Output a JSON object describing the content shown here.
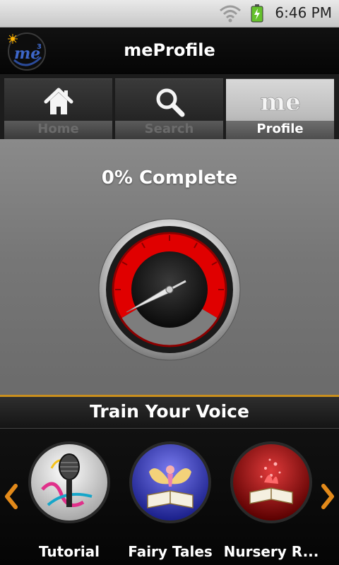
{
  "status_bar": {
    "time": "6:46 PM"
  },
  "app": {
    "title": "meProfile",
    "logo_text": "me"
  },
  "tabs": [
    {
      "label": "Home",
      "icon": "home-icon",
      "active": false
    },
    {
      "label": "Search",
      "icon": "search-icon",
      "active": false
    },
    {
      "label": "Profile",
      "icon": "me-icon",
      "active": true,
      "icon_text": "me"
    }
  ],
  "profile": {
    "progress_label": "0% Complete",
    "progress_value": 0
  },
  "train": {
    "title": "Train Your Voice",
    "items": [
      {
        "label": "Tutorial",
        "icon": "microphone-icon"
      },
      {
        "label": "Fairy Tales",
        "icon": "fairy-book-icon"
      },
      {
        "label": "Nursery R...",
        "icon": "magic-book-icon"
      }
    ]
  },
  "colors": {
    "accent": "#e38a1a",
    "gauge_red": "#e00000",
    "header_bg": "#0b0b0b"
  }
}
